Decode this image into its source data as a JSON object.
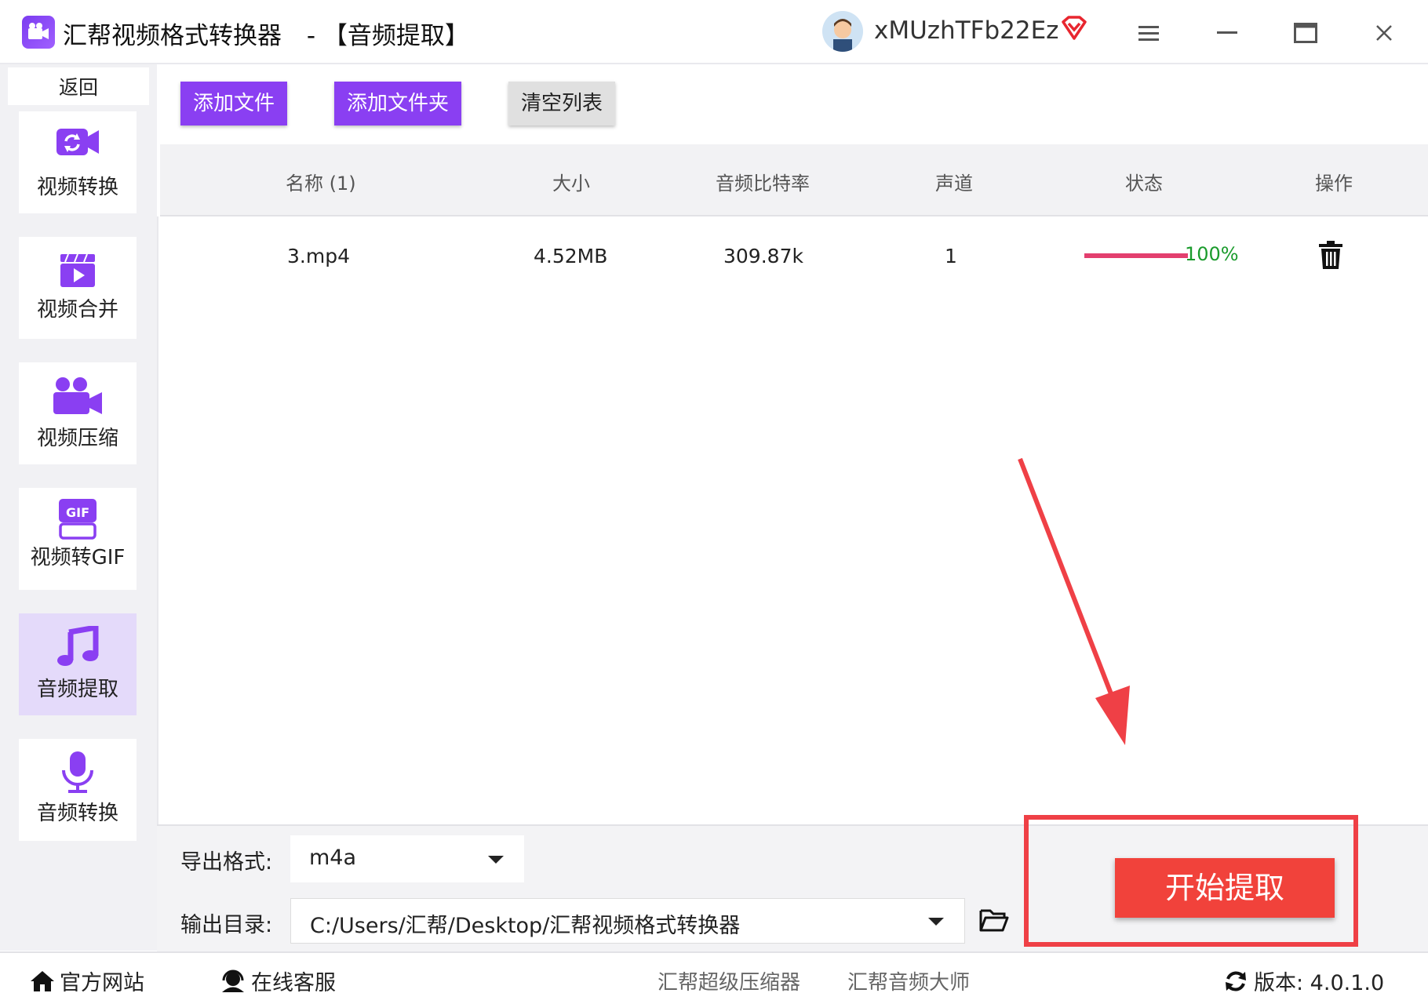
{
  "window": {
    "title": "汇帮视频格式转换器",
    "subtitle": "- 【音频提取】",
    "username": "xMUzhTFb22Ez",
    "controls": [
      "menu-icon",
      "minimize-icon",
      "maximize-icon",
      "close-icon"
    ]
  },
  "sidebar": {
    "back_label": "返回",
    "items": [
      {
        "label": "视频转换",
        "icon": "video-convert-icon"
      },
      {
        "label": "视频合并",
        "icon": "video-merge-icon"
      },
      {
        "label": "视频压缩",
        "icon": "video-compress-icon"
      },
      {
        "label": "视频转GIF",
        "icon": "gif-icon"
      },
      {
        "label": "音频提取",
        "icon": "music-note-icon",
        "active": true
      },
      {
        "label": "音频转换",
        "icon": "microphone-icon"
      }
    ]
  },
  "toolbar": {
    "add_file": "添加文件",
    "add_folder": "添加文件夹",
    "clear_list": "清空列表"
  },
  "table": {
    "headers": [
      "名称 (1)",
      "大小",
      "音频比特率",
      "声道",
      "状态",
      "操作"
    ],
    "rows": [
      {
        "name": "3.mp4",
        "size": "4.52MB",
        "bitrate": "309.87k",
        "channels": "1",
        "progress": 1.0,
        "status": "100%"
      }
    ]
  },
  "settings": {
    "format_label": "导出格式:",
    "format_value": "m4a",
    "dir_label": "输出目录:",
    "dir_value": "C:/Users/汇帮/Desktop/汇帮视频格式转换器",
    "start_button": "开始提取"
  },
  "footer": {
    "website": "官方网站",
    "support": "在线客服",
    "link1": "汇帮超级压缩器",
    "link2": "汇帮音频大师",
    "version": "版本: 4.0.1.0"
  },
  "colors": {
    "accent": "#8a3ff2",
    "start": "#f1423b",
    "highlight": "#ef4046",
    "progress": "#e33f6f",
    "status_text": "#1a9b2c"
  }
}
